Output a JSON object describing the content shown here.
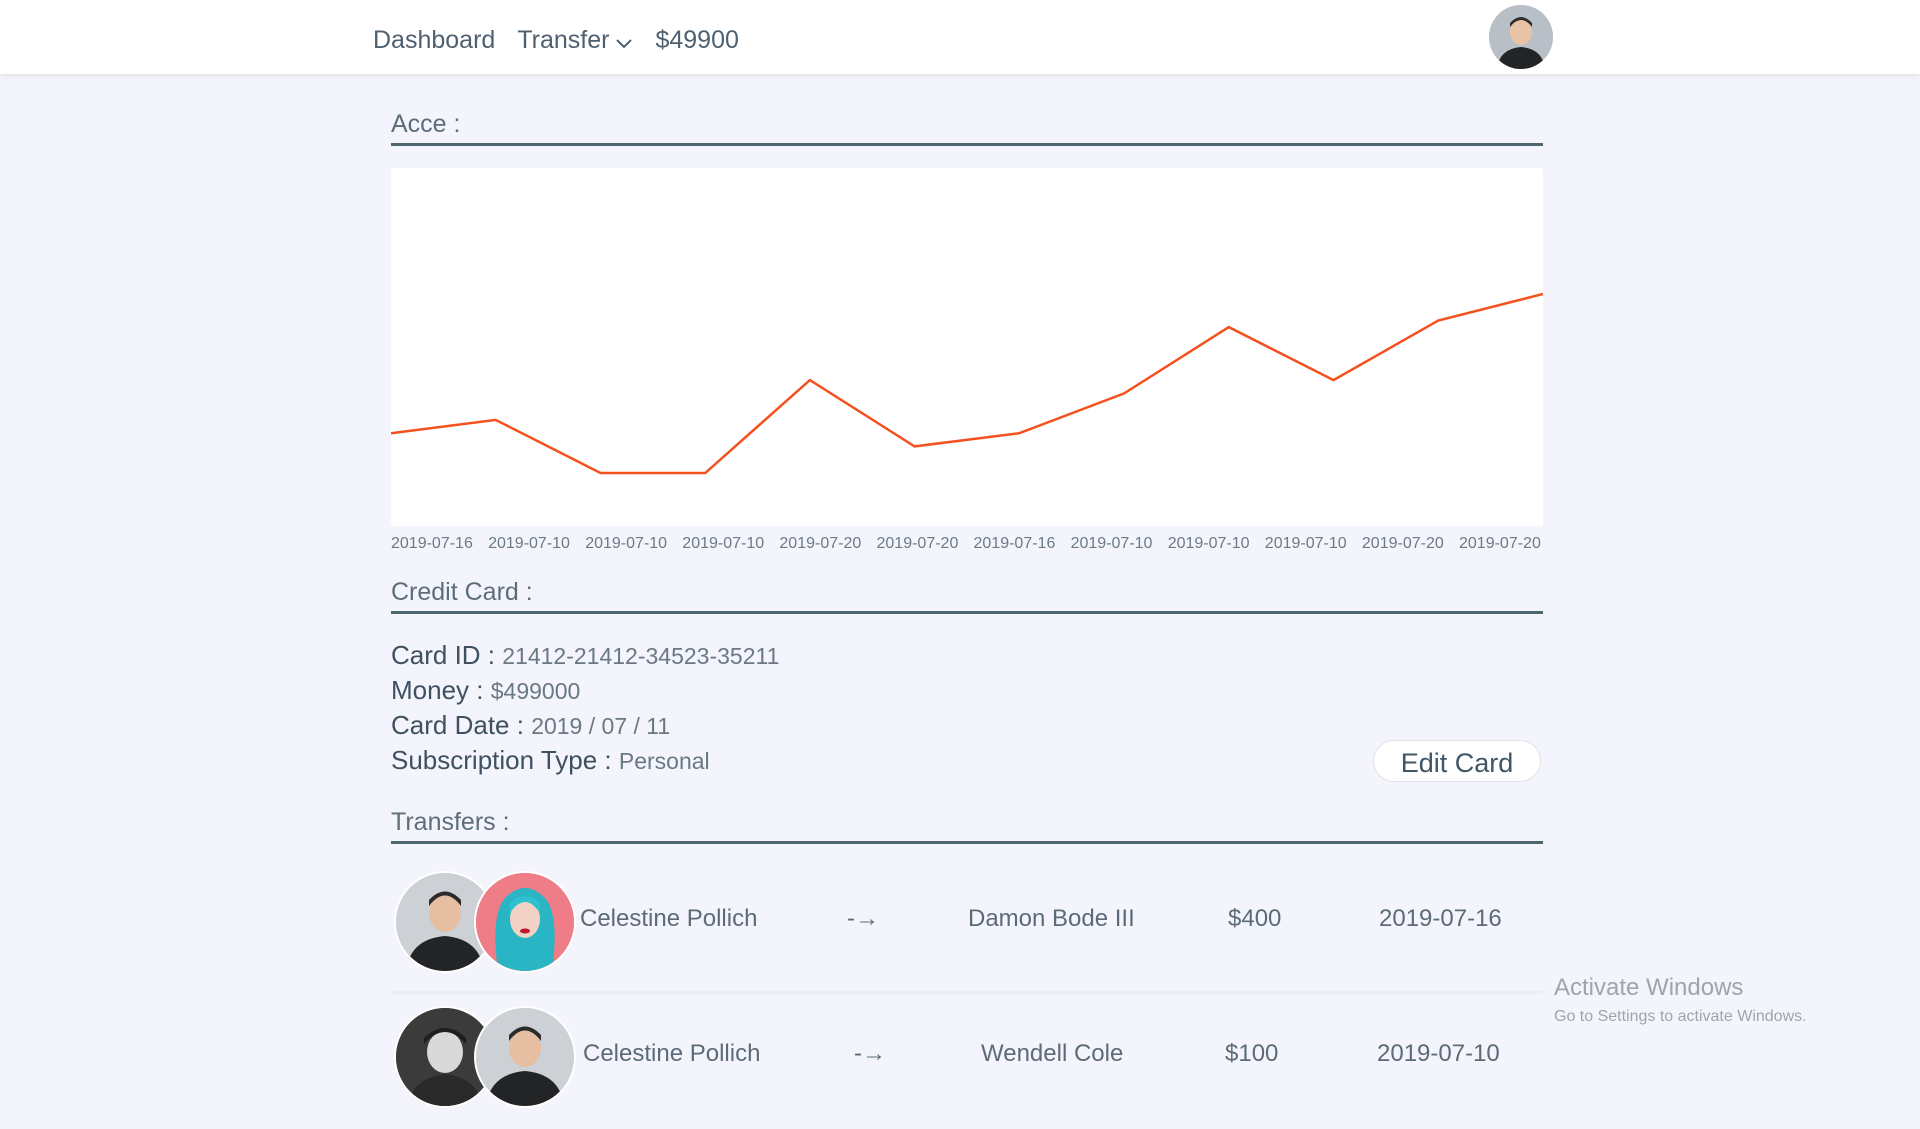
{
  "nav": {
    "dashboard": "Dashboard",
    "transfer": "Transfer",
    "balance": "$49900"
  },
  "sections": {
    "account": "Acce :",
    "credit_card": "Credit Card :",
    "transfers": "Transfers :"
  },
  "chart_data": {
    "type": "line",
    "categories": [
      "2019-07-16",
      "2019-07-10",
      "2019-07-10",
      "2019-07-10",
      "2019-07-20",
      "2019-07-20",
      "2019-07-16",
      "2019-07-10",
      "2019-07-10",
      "2019-07-10",
      "2019-07-20",
      "2019-07-20"
    ],
    "series": [
      {
        "values": [
          400,
          500,
          100,
          100,
          800,
          300,
          400,
          700,
          1200,
          800,
          1250,
          1450
        ]
      }
    ],
    "ylim": [
      -300,
      2400
    ],
    "line_color": "#f4511e",
    "grid": false
  },
  "card": {
    "id_label": "Card ID :",
    "id_value": "21412-21412-34523-35211",
    "money_label": "Money :",
    "money_value": "$499000",
    "date_label": "Card Date :",
    "date_value": "2019 / 07 / 11",
    "sub_label": "Subscription Type :",
    "sub_value": "Personal",
    "edit_label": "Edit Card"
  },
  "transfers": [
    {
      "from": "Celestine Pollich",
      "arrow": "-→",
      "to": "Damon Bode III",
      "amount": "$400",
      "date": "2019-07-16"
    },
    {
      "from": "Celestine Pollich",
      "arrow": "-→",
      "to": "Wendell Cole",
      "amount": "$100",
      "date": "2019-07-10"
    }
  ],
  "watermark": {
    "line1": "Activate Windows",
    "line2": "Go to Settings to activate Windows."
  },
  "colors": {
    "accent_line": "#f4511e",
    "section_rule": "#4f6570"
  }
}
